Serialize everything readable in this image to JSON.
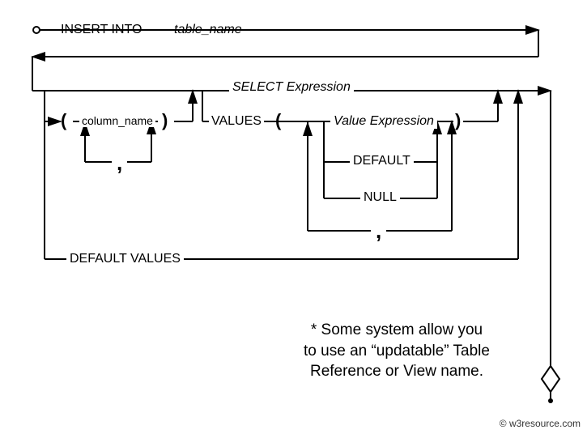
{
  "diagram": {
    "insert_into": "INSERT INTO",
    "table_name": "table_name",
    "select_expr": "SELECT Expression",
    "column_name": "column_name",
    "values_kw": "VALUES",
    "value_expr": "Value Expression",
    "default_kw": "DEFAULT",
    "null_kw": "NULL",
    "default_values": "DEFAULT VALUES",
    "lparen": "(",
    "rparen": ")",
    "comma1": ",",
    "comma2": ","
  },
  "note_line1": "* Some system allow you",
  "note_line2": "to use an “updatable” Table",
  "note_line3": "Reference or View name.",
  "copyright": "© w3resource.com"
}
